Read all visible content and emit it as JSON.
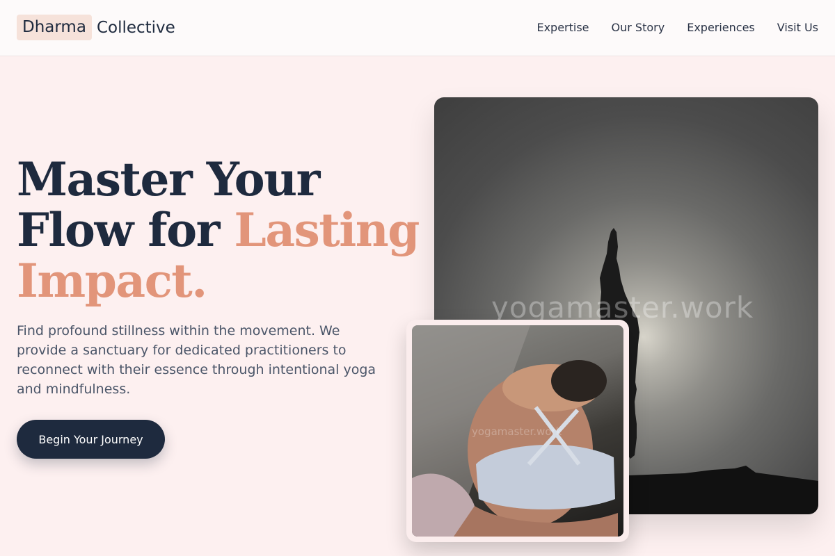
{
  "brand": {
    "badge": "Dharma",
    "name": "Collective"
  },
  "nav": {
    "items": [
      {
        "label": "Expertise"
      },
      {
        "label": "Our Story"
      },
      {
        "label": "Experiences"
      },
      {
        "label": "Visit Us"
      }
    ]
  },
  "hero": {
    "title_line1": "Master Your",
    "title_line2a": "Flow for ",
    "title_accent1": "Lasting",
    "title_accent2": "Impact.",
    "description": "Find profound stillness within the movement. We provide a sanctuary for dedicated practitioners to reconnect with their essence through intentional yoga and mindfulness.",
    "cta_label": "Begin Your Journey"
  },
  "images": {
    "main_watermark": "yogamaster.work",
    "inset_watermark": "yogamaster.work",
    "main_alt": "silhouette-yoga-pose",
    "inset_alt": "yoga-back-stretch"
  },
  "colors": {
    "background": "#fdf0f0",
    "navy": "#1e2a3e",
    "accent": "#e2957a",
    "logo_badge": "#f6e2da"
  }
}
